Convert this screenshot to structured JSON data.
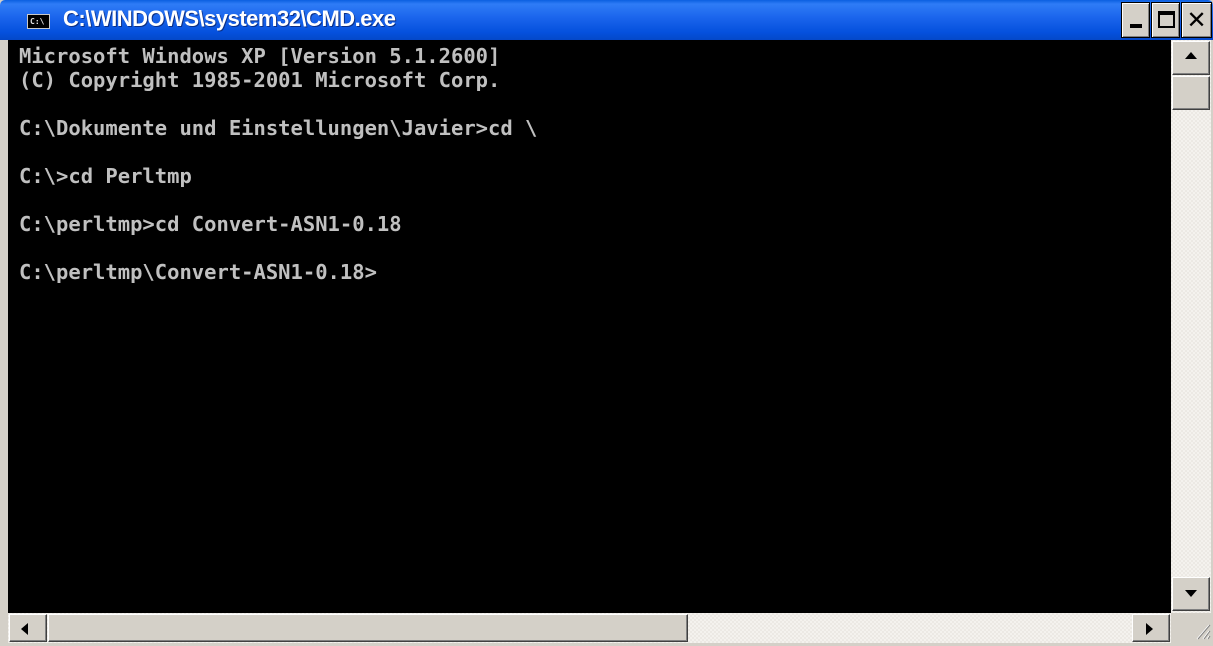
{
  "window": {
    "title": "C:\\WINDOWS\\system32\\CMD.exe",
    "icon": "cmd-icon",
    "icon_text": "C:\\"
  },
  "caption_buttons": {
    "minimize_icon": "minimize-icon",
    "maximize_icon": "maximize-icon",
    "close_icon": "close-icon",
    "close_glyph": "✕"
  },
  "console": {
    "lines": [
      "Microsoft Windows XP [Version 5.1.2600]",
      "(C) Copyright 1985-2001 Microsoft Corp.",
      "",
      "C:\\Dokumente und Einstellungen\\Javier>cd \\",
      "",
      "C:\\>cd Perltmp",
      "",
      "C:\\perltmp>cd Convert-ASN1-0.18",
      "",
      "C:\\perltmp\\Convert-ASN1-0.18>"
    ],
    "background": "#000000",
    "foreground": "#c0c0c0"
  },
  "scrollbars": {
    "vertical_thumb_position": 0.0,
    "horizontal_thumb_position": 0.0,
    "horizontal_thumb_fraction": 0.6
  },
  "colors": {
    "titlebar": "#0551de",
    "chrome": "#d4d0c8"
  }
}
